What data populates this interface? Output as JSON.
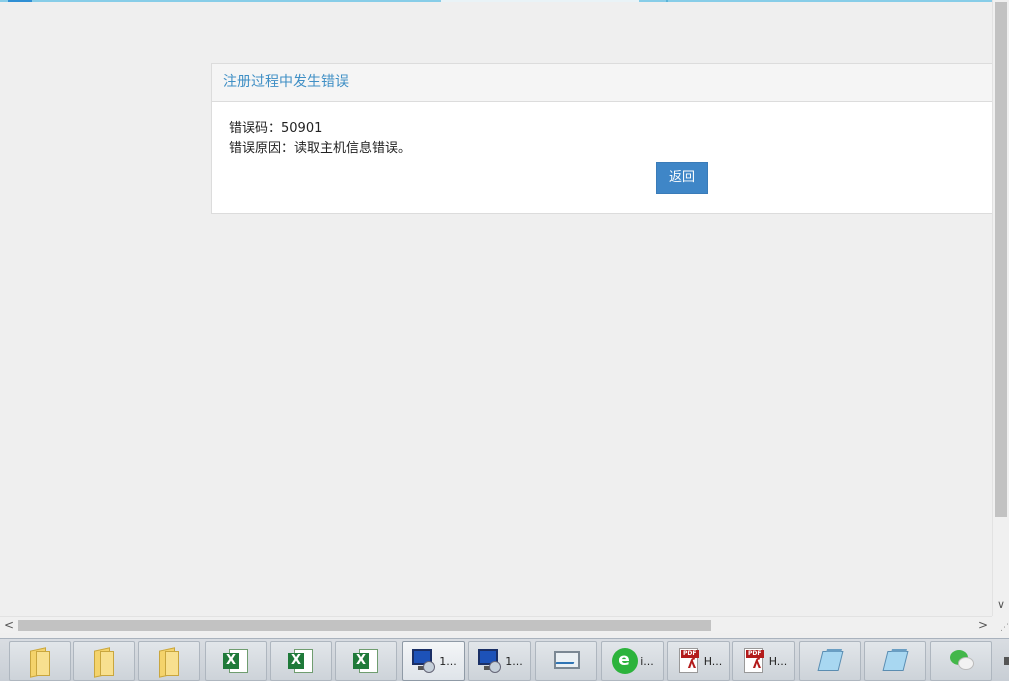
{
  "error_panel": {
    "title": "注册过程中发生错误",
    "code_label": "错误码：",
    "code_value": "50901",
    "reason_label": "错误原因：",
    "reason_value": "读取主机信息错误。",
    "return_button": "返回"
  },
  "scrollbars": {
    "vertical_down_arrow": "∨",
    "horizontal_left_arrow": "<",
    "horizontal_right_arrow": ">"
  },
  "taskbar": {
    "items": [
      {
        "icon": "folder-icon",
        "label": ""
      },
      {
        "icon": "folder-icon",
        "label": ""
      },
      {
        "icon": "folder-icon",
        "label": ""
      },
      {
        "icon": "excel-icon",
        "label": ""
      },
      {
        "icon": "excel-icon",
        "label": ""
      },
      {
        "icon": "excel-icon",
        "label": ""
      },
      {
        "icon": "remote-desktop-icon",
        "label": "1..."
      },
      {
        "icon": "remote-desktop-icon",
        "label": "1..."
      },
      {
        "icon": "performance-monitor-icon",
        "label": ""
      },
      {
        "icon": "browser-icon",
        "label": "i..."
      },
      {
        "icon": "pdf-icon",
        "label": "H..."
      },
      {
        "icon": "pdf-icon",
        "label": "H..."
      },
      {
        "icon": "notepad-icon",
        "label": ""
      },
      {
        "icon": "notepad-icon",
        "label": ""
      },
      {
        "icon": "wechat-icon",
        "label": ""
      }
    ]
  }
}
